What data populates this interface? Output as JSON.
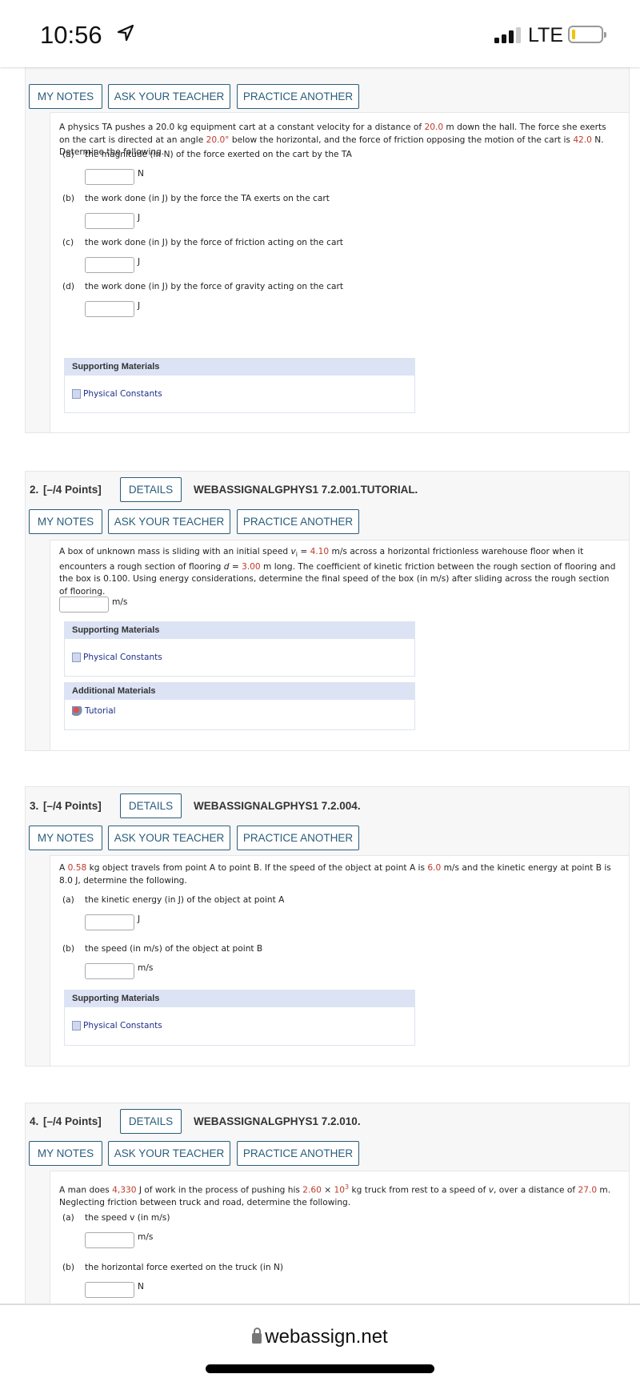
{
  "status_bar": {
    "time": "10:56",
    "network": "LTE",
    "icons": [
      "location-arrow-icon",
      "signal-icon",
      "battery-icon"
    ]
  },
  "colors": {
    "accent": "#2a5d7c",
    "given_value": "#c0392b",
    "materials_header": "#dce3f5",
    "link": "#1f2f8a"
  },
  "buttons": {
    "my_notes": "MY NOTES",
    "ask_teacher": "ASK YOUR TEACHER",
    "practice": "PRACTICE ANOTHER",
    "details": "DETAILS"
  },
  "materials": {
    "supporting": "Supporting Materials",
    "additional": "Additional Materials",
    "physical_constants": "Physical Constants",
    "tutorial": "Tutorial"
  },
  "problems": [
    {
      "number": "",
      "points": "",
      "code": "",
      "text": [
        {
          "t": "A physics TA pushes a 20.0 kg equipment cart at a constant velocity for a distance of "
        },
        {
          "t": "20.0",
          "red": true
        },
        {
          "t": " m down the hall. The force she exerts on the cart is directed at an angle "
        },
        {
          "t": "20.0°",
          "red": true
        },
        {
          "t": " below the horizontal, and the force of friction opposing the motion of the cart is "
        },
        {
          "t": "42.0",
          "red": true
        },
        {
          "t": " N. Determine the following."
        }
      ],
      "parts": [
        {
          "label": "(a)",
          "prompt": "the magnitude (in N) of the force exerted on the cart by the TA",
          "unit": "N"
        },
        {
          "label": "(b)",
          "prompt": "the work done (in J) by the force the TA exerts on the cart",
          "unit": "J"
        },
        {
          "label": "(c)",
          "prompt": "the work done (in J) by the force of friction acting on the cart",
          "unit": "J"
        },
        {
          "label": "(d)",
          "prompt": "the work done (in J) by the force of gravity acting on the cart",
          "unit": "J"
        }
      ]
    },
    {
      "number": "2.",
      "points": "[–/4 Points]",
      "code": "WEBASSIGNALGPHYS1 7.2.001.TUTORIAL.",
      "text": [
        {
          "t": "A box of unknown mass is sliding with an initial speed "
        },
        {
          "t": "v",
          "italic": true
        },
        {
          "t": "i",
          "sub": true
        },
        {
          "t": " = "
        },
        {
          "t": "4.10",
          "red": true
        },
        {
          "t": " m/s across a horizontal frictionless warehouse floor when it encounters a rough section of flooring "
        },
        {
          "t": "d",
          "italic": true
        },
        {
          "t": " = "
        },
        {
          "t": "3.00",
          "red": true
        },
        {
          "t": " m long. The coefficient of kinetic friction between the rough section of flooring and the box is 0.100. Using energy considerations, determine the final speed of the box (in m/s) after sliding across the rough section of flooring."
        }
      ],
      "answer_unit": "m/s"
    },
    {
      "number": "3.",
      "points": "[–/4 Points]",
      "code": "WEBASSIGNALGPHYS1 7.2.004.",
      "text": [
        {
          "t": "A "
        },
        {
          "t": "0.58",
          "red": true
        },
        {
          "t": " kg object travels from point A to point B. If the speed of the object at point A is "
        },
        {
          "t": "6.0",
          "red": true
        },
        {
          "t": " m/s and the kinetic energy at point B is 8.0 J, determine the following."
        }
      ],
      "parts": [
        {
          "label": "(a)",
          "prompt": "the kinetic energy (in J) of the object at point A",
          "unit": "J"
        },
        {
          "label": "(b)",
          "prompt": "the speed (in m/s) of the object at point B",
          "unit": "m/s"
        }
      ]
    },
    {
      "number": "4.",
      "points": "[–/4 Points]",
      "code": "WEBASSIGNALGPHYS1 7.2.010.",
      "text": [
        {
          "t": "A man does "
        },
        {
          "t": "4,330",
          "red": true
        },
        {
          "t": " J of work in the process of pushing his "
        },
        {
          "t": "2.60",
          "red": true
        },
        {
          "t": " × "
        },
        {
          "t": "10",
          "red": true
        },
        {
          "t": "3",
          "sup": true,
          "red": true
        },
        {
          "t": " kg truck from rest to a speed of "
        },
        {
          "t": "v",
          "italic": true
        },
        {
          "t": ", over a distance of "
        },
        {
          "t": "27.0",
          "red": true
        },
        {
          "t": " m. Neglecting friction between truck and road, determine the following."
        }
      ],
      "parts": [
        {
          "label": "(a)",
          "prompt": "the speed v (in m/s)",
          "unit": "m/s"
        },
        {
          "label": "(b)",
          "prompt": "the horizontal force exerted on the truck (in N)",
          "unit": "N"
        }
      ]
    }
  ],
  "browser": {
    "url": "webassign.net"
  }
}
